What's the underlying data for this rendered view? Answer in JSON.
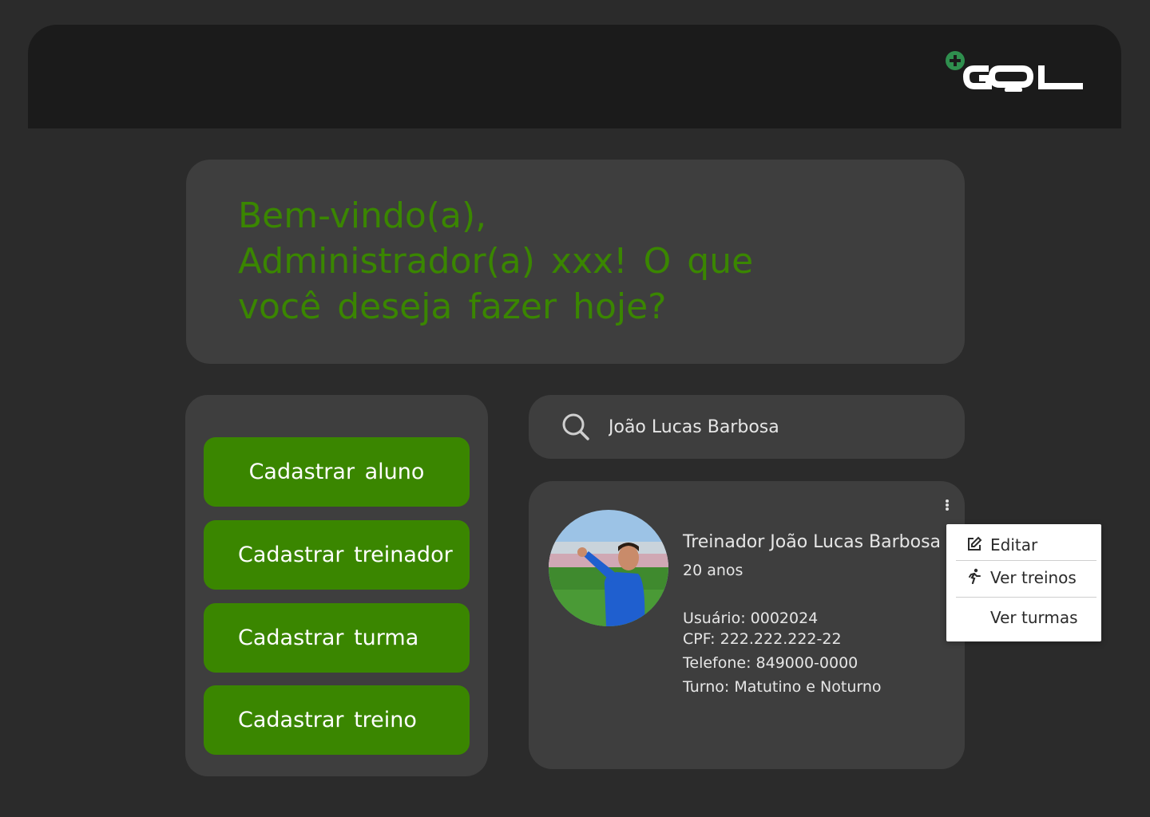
{
  "header": {
    "logo_text": "GOL",
    "logo_icon": "plus-icon"
  },
  "welcome": {
    "message": "Bem-vindo(a), Administrador(a) xxx! O que você deseja fazer hoje?"
  },
  "actions": [
    {
      "label": "Cadastrar aluno"
    },
    {
      "label": "Cadastrar treinador"
    },
    {
      "label": "Cadastrar turma"
    },
    {
      "label": "Cadastrar treino"
    }
  ],
  "search": {
    "value": "João Lucas Barbosa",
    "icon": "search-icon"
  },
  "profile": {
    "name": "Treinador João Lucas Barbosa",
    "age": "20 anos",
    "user": "Usuário: 0002024",
    "cpf": "CPF: 222.222.222-22",
    "phone": "Telefone: 849000-0000",
    "shift": "Turno: Matutino e Noturno"
  },
  "menu": {
    "items": [
      {
        "label": "Editar",
        "icon": "edit-icon"
      },
      {
        "label": "Ver treinos",
        "icon": "running-icon"
      },
      {
        "label": "Ver turmas",
        "icon": ""
      }
    ]
  },
  "colors": {
    "accent": "#3a8600",
    "background": "#2b2b2b",
    "card": "#3e3e3e",
    "header": "#1b1b1b",
    "logo_plus": "#2f8f4e"
  }
}
